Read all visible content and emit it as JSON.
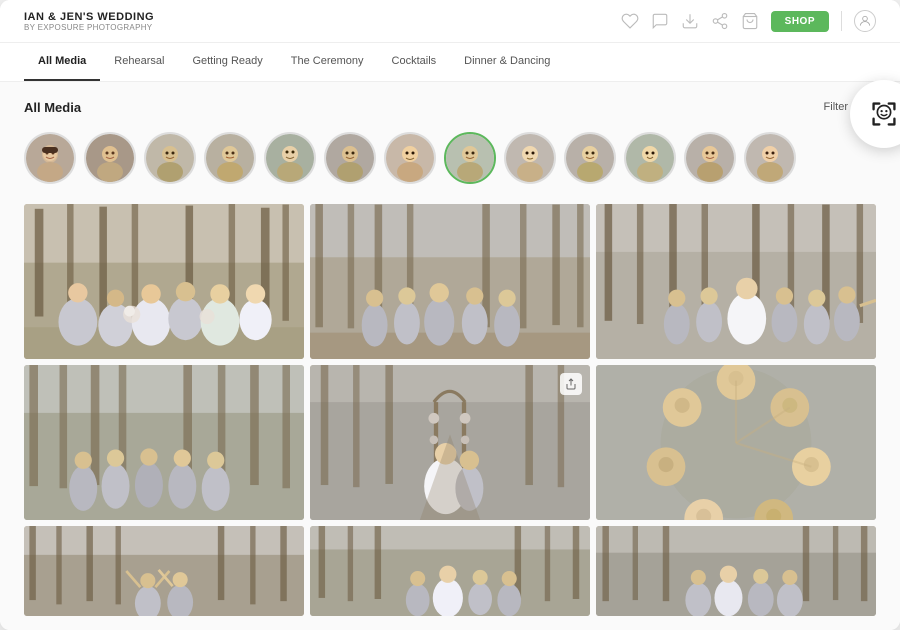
{
  "header": {
    "title": "IAN & JEN'S WEDDING",
    "subtitle": "BY EXPOSURE PHOTOGRAPHY",
    "shop_label": "SHOP"
  },
  "nav": {
    "items": [
      {
        "label": "All Media",
        "active": true
      },
      {
        "label": "Rehearsal",
        "active": false
      },
      {
        "label": "Getting Ready",
        "active": false
      },
      {
        "label": "The Ceremony",
        "active": false
      },
      {
        "label": "Cocktails",
        "active": false
      },
      {
        "label": "Dinner & Dancing",
        "active": false
      }
    ]
  },
  "section": {
    "title": "All Media",
    "filter_label": "Filter"
  },
  "faces": {
    "count": 13,
    "selected_index": 7
  },
  "grid": {
    "rows": [
      [
        {
          "id": "p1",
          "size": "large",
          "has_share": false
        },
        {
          "id": "p2",
          "size": "large",
          "has_share": false
        },
        {
          "id": "p3",
          "size": "large",
          "has_share": false
        }
      ],
      [
        {
          "id": "p4",
          "size": "large",
          "has_share": false
        },
        {
          "id": "p5",
          "size": "large",
          "has_share": true
        },
        {
          "id": "p6",
          "size": "large",
          "has_share": false
        }
      ],
      [
        {
          "id": "p7",
          "size": "small",
          "has_share": false
        },
        {
          "id": "p8",
          "size": "small",
          "has_share": false
        },
        {
          "id": "p9",
          "size": "small",
          "has_share": false
        }
      ]
    ]
  }
}
